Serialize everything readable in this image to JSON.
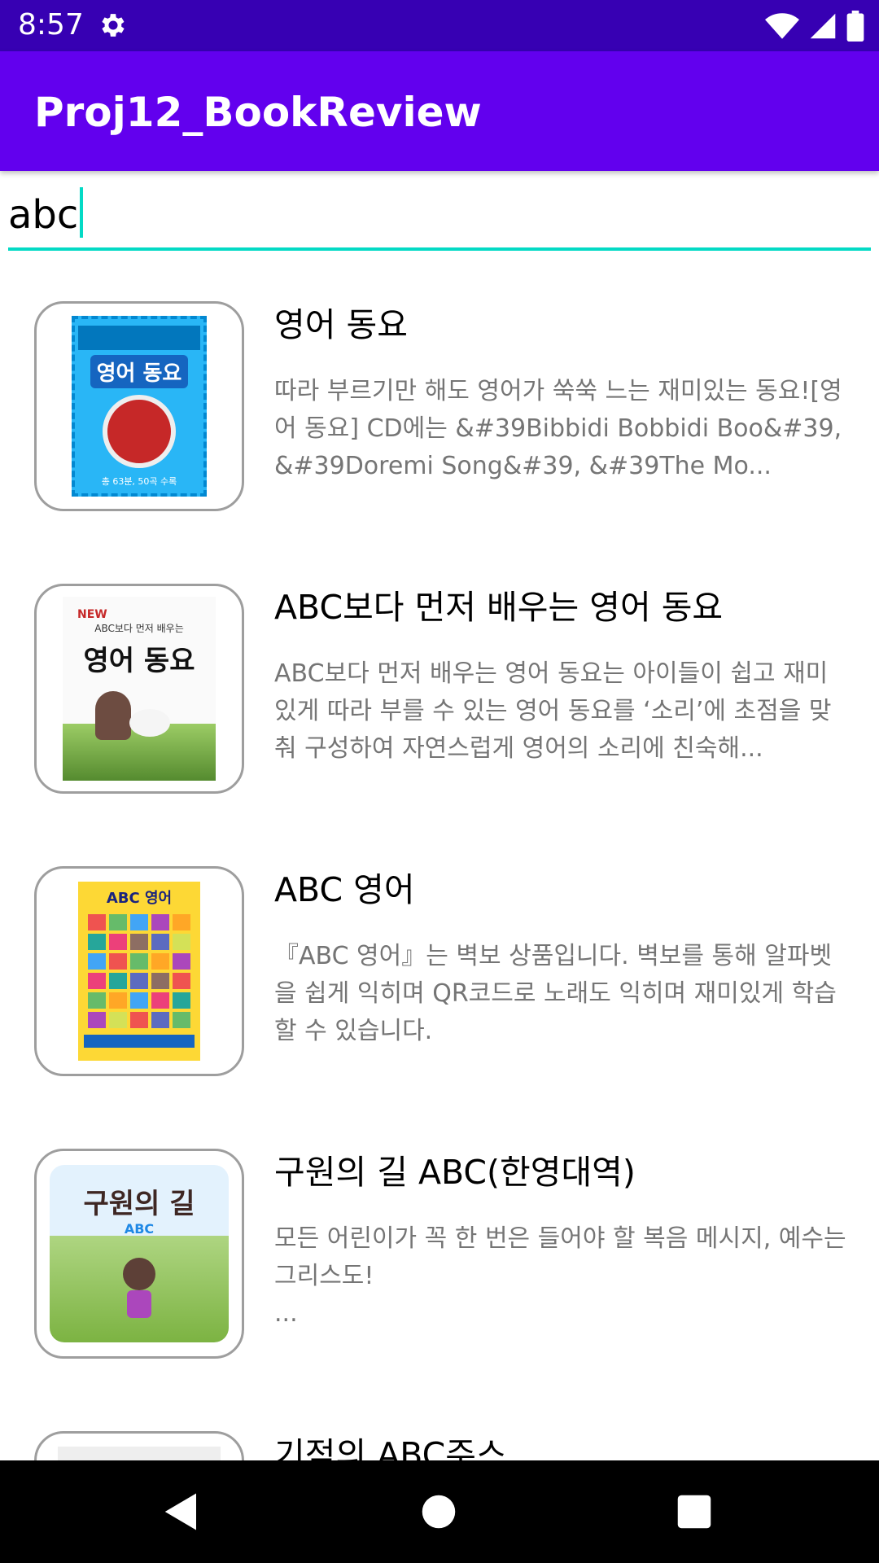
{
  "status": {
    "time": "8:57",
    "icons": [
      "gear-icon",
      "wifi-icon",
      "signal-icon",
      "battery-icon"
    ]
  },
  "app": {
    "title": "Proj12_BookReview"
  },
  "search": {
    "value": "abc"
  },
  "books": [
    {
      "title": "영어 동요",
      "description": "따라 부르기만 해도 영어가 쑥쑥 느는 재미있는 동요![영어 동요] CD에는 &#39Bibbidi Bobbidi Boo&#39, &#39Doremi Song&#39, &#39The Mo...",
      "cover_text": "영어 동요",
      "cover_sub": "총 63분, 50곡 수록",
      "cover_color": "#4fc3f7"
    },
    {
      "title": "ABC보다 먼저 배우는 영어 동요",
      "description": "ABC보다 먼저 배우는 영어 동요는 아이들이 쉽고 재미있게 따라 부를 수 있는 영어 동요를 ‘소리’에 초점을 맞춰 구성하여 자연스럽게 영어의 소리에 친숙해...",
      "cover_text": "영어 동요",
      "cover_sub": "ABC보다 먼저 배우는",
      "cover_color": "#f5f5f5"
    },
    {
      "title": "ABC 영어",
      "description": "『ABC 영어』는 벽보 상품입니다. 벽보를 통해 알파벳을 쉽게 익히며 QR코드로 노래도 익히며 재미있게 학습할 수 있습니다.",
      "cover_text": "ABC 영어",
      "cover_sub": "",
      "cover_color": "#fdd835"
    },
    {
      "title": "구원의 길 ABC(한영대역)",
      "description": "모든 어린이가 꼭 한 번은 들어야 할 복음 메시지, 예수는 그리스도!\n...",
      "cover_text": "구원의 길",
      "cover_sub": "ABC",
      "cover_color": "#aed581"
    },
    {
      "title": "기적의 ABC주스",
      "description": "",
      "cover_text": "",
      "cover_sub": "",
      "cover_color": "#eeeeee"
    }
  ],
  "nav": {
    "icons": [
      "back-icon",
      "home-icon",
      "recents-icon"
    ]
  }
}
